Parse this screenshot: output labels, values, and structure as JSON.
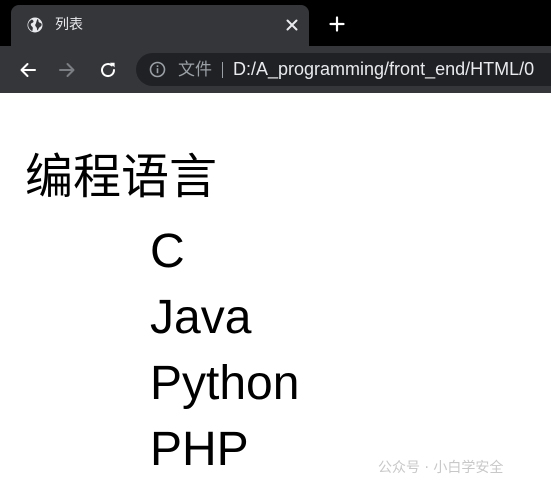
{
  "tab": {
    "title": "列表",
    "favicon": "globe-icon",
    "close_icon": "close-icon"
  },
  "new_tab_icon": "plus-icon",
  "toolbar": {
    "back_icon": "arrow-left-icon",
    "forward_icon": "arrow-right-icon",
    "reload_icon": "reload-icon",
    "info_icon": "info-icon",
    "scheme_label": "文件",
    "url": "D:/A_programming/front_end/HTML/0"
  },
  "page": {
    "heading": "编程语言",
    "languages": [
      "C",
      "Java",
      "Python",
      "PHP"
    ]
  },
  "watermark": "公众号 · 小白学安全",
  "colors": {
    "tabstrip_bg": "#000000",
    "active_tab_bg": "#35363a",
    "toolbar_bg": "#35363a",
    "omnibox_bg": "#202124",
    "tab_text": "#e8eaed",
    "muted_text": "#9aa0a6",
    "page_bg": "#ffffff",
    "page_text": "#000000"
  }
}
